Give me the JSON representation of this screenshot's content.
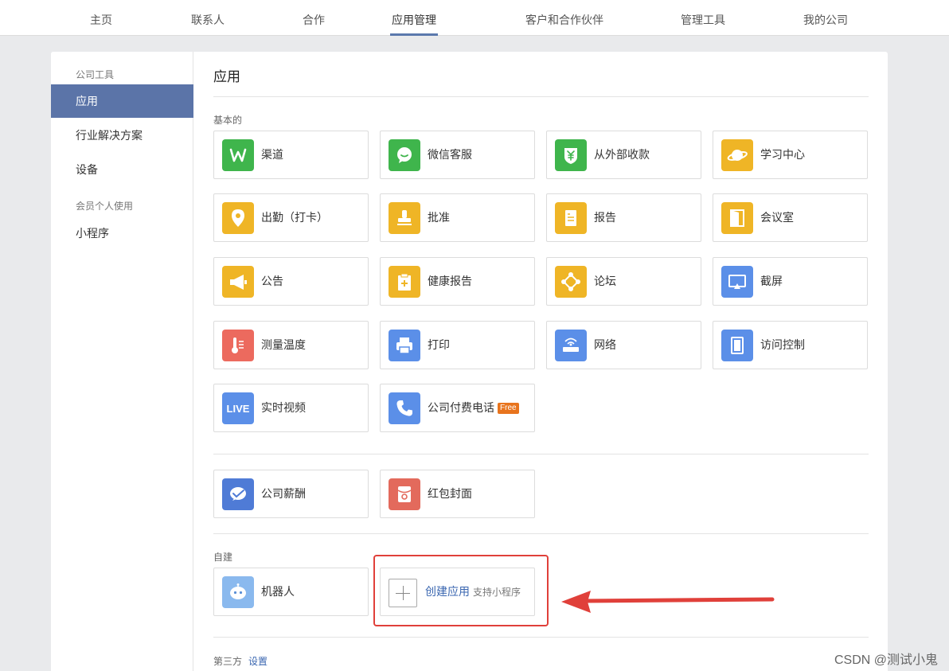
{
  "topnav": {
    "tabs": [
      {
        "label": "主页"
      },
      {
        "label": "联系人"
      },
      {
        "label": "合作"
      },
      {
        "label": "应用管理"
      },
      {
        "label": "客户和合作伙伴"
      },
      {
        "label": "管理工具"
      },
      {
        "label": "我的公司"
      }
    ],
    "active_index": 3
  },
  "sidebar": {
    "group1_heading": "公司工具",
    "items": [
      {
        "label": "应用"
      },
      {
        "label": "行业解决方案"
      },
      {
        "label": "设备"
      }
    ],
    "group2_heading": "会员个人使用",
    "items2": [
      {
        "label": "小程序"
      }
    ]
  },
  "main": {
    "title": "应用",
    "basic_label": "基本的",
    "apps": [
      {
        "label": "渠道",
        "icon": "channel-icon",
        "color": "#3fb54c"
      },
      {
        "label": "微信客服",
        "icon": "wechat-service-icon",
        "color": "#3fb54c"
      },
      {
        "label": "从外部收款",
        "icon": "yuan-shield-icon",
        "color": "#3fb54c"
      },
      {
        "label": "学习中心",
        "icon": "planet-icon",
        "color": "#efb526"
      },
      {
        "label": "出勤（打卡）",
        "icon": "location-pin-icon",
        "color": "#efb526"
      },
      {
        "label": "批准",
        "icon": "stamp-icon",
        "color": "#efb526"
      },
      {
        "label": "报告",
        "icon": "report-document-icon",
        "color": "#efb526"
      },
      {
        "label": "会议室",
        "icon": "door-icon",
        "color": "#efb526"
      },
      {
        "label": "公告",
        "icon": "megaphone-icon",
        "color": "#efb526"
      },
      {
        "label": "健康报告",
        "icon": "health-clipboard-icon",
        "color": "#efb526"
      },
      {
        "label": "论坛",
        "icon": "forum-nodes-icon",
        "color": "#efb526"
      },
      {
        "label": "截屏",
        "icon": "screen-cast-icon",
        "color": "#5b8fe8"
      },
      {
        "label": "测量温度",
        "icon": "thermometer-icon",
        "color": "#ec6a5e"
      },
      {
        "label": "打印",
        "icon": "printer-icon",
        "color": "#5b8fe8"
      },
      {
        "label": "网络",
        "icon": "router-icon",
        "color": "#5b8fe8"
      },
      {
        "label": "访问控制",
        "icon": "access-door-icon",
        "color": "#5b8fe8"
      },
      {
        "label": "实时视频",
        "icon": "live-icon",
        "color": "#5b8fe8",
        "icon_text": "LIVE"
      },
      {
        "label": "公司付费电话",
        "icon": "phone-icon",
        "color": "#5b8fe8",
        "badge": "Free"
      }
    ],
    "extra_apps": [
      {
        "label": "公司薪酬",
        "icon": "salary-icon",
        "color": "#4f7bd6"
      },
      {
        "label": "红包封面",
        "icon": "red-envelope-icon",
        "color": "#e36a5c"
      }
    ],
    "custom_label": "自建",
    "custom_apps": [
      {
        "label": "机器人",
        "icon": "robot-icon",
        "color": "#8ab9ee"
      }
    ],
    "create": {
      "label": "创建应用",
      "sub": "支持小程序"
    },
    "third_party_label": "第三方",
    "third_party_link": "设置"
  },
  "annotation": {
    "highlight_color": "#e0403a"
  },
  "watermark": "CSDN @测试小鬼"
}
